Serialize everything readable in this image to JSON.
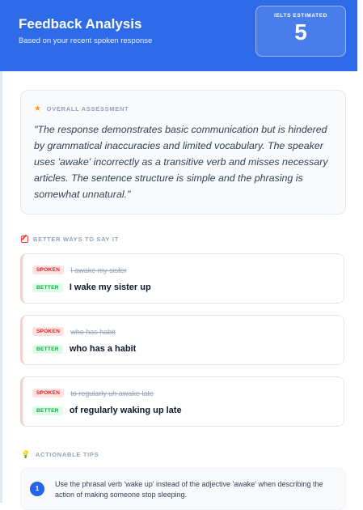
{
  "header": {
    "title": "Feedback Analysis",
    "subtitle": "Based on your recent spoken response",
    "score_label": "IELTS ESTIMATED",
    "score": "5"
  },
  "assessment": {
    "heading": "OVERALL ASSESSMENT",
    "quote": "\"The response demonstrates basic communication but is hindered by grammatical inaccuracies and limited vocabulary. The speaker uses 'awake' incorrectly as a transitive verb and misses necessary articles. The sentence structure is simple and the phrasing is somewhat unnatural.\""
  },
  "better_ways": {
    "heading": "BETTER WAYS TO SAY IT",
    "spoken_badge": "SPOKEN",
    "better_badge": "BETTER",
    "items": [
      {
        "spoken": "I awake my sister",
        "better": "I wake my sister up"
      },
      {
        "spoken": "who has habit",
        "better": "who has a habit"
      },
      {
        "spoken": "to regularly uh awake late",
        "better": "of regularly waking up late"
      }
    ]
  },
  "tips": {
    "heading": "ACTIONABLE TIPS",
    "items": [
      {
        "number": "1",
        "text": "Use the phrasal verb 'wake up' instead of the adjective 'awake' when describing the action of making someone stop sleeping."
      }
    ]
  },
  "colors": {
    "accent": "#2f6be8",
    "spoken": "#dc2626",
    "better": "#16a34a"
  }
}
